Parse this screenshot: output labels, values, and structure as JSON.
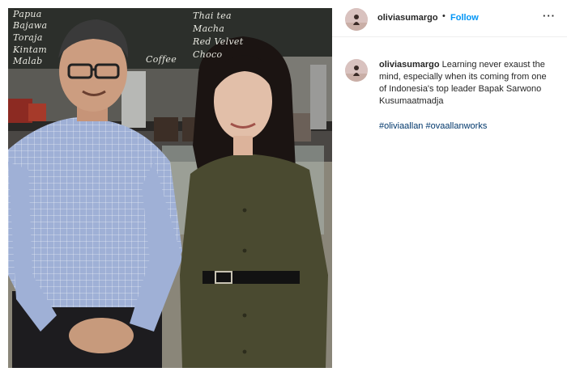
{
  "post": {
    "username": "oliviasumargo",
    "follow_label": "Follow",
    "separator": "•",
    "more_icon_label": "···",
    "caption_text": "Learning never exaust the mind, especially when its coming from one of Indonesia's top leader Bapak Sarwono Kusumaatmadja",
    "hashtags": [
      "#oliviaallan",
      "#ovaallanworks"
    ]
  },
  "photo": {
    "menu_board": {
      "lines": [
        "Papua",
        "Bajawa",
        "Toraja",
        "Kintam",
        "Malab",
        "Thai tea",
        "Macha",
        "Red Velvet",
        "Choco",
        "Coffee"
      ]
    }
  },
  "colors": {
    "follow_blue": "#0095f6",
    "hashtag_blue": "#00376b",
    "text_dark": "#262626",
    "divider": "#efefef"
  },
  "icons": {
    "more": "horizontal-ellipsis-icon",
    "avatar": "profile-avatar"
  }
}
